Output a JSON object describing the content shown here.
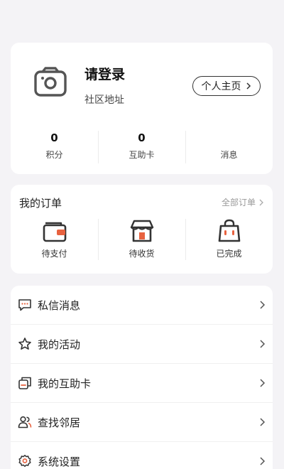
{
  "profile": {
    "login_title": "请登录",
    "community_address": "社区地址",
    "home_button_label": "个人主页",
    "stats": [
      {
        "value": "0",
        "label": "积分"
      },
      {
        "value": "0",
        "label": "互助卡"
      },
      {
        "value": "",
        "label": "消息"
      }
    ]
  },
  "orders": {
    "title": "我的订单",
    "all_label": "全部订单",
    "items": [
      {
        "label": "待支付",
        "icon": "wallet-icon"
      },
      {
        "label": "待收货",
        "icon": "shop-icon"
      },
      {
        "label": "已完成",
        "icon": "bag-icon"
      }
    ]
  },
  "menu": {
    "items": [
      {
        "label": "私信消息",
        "icon": "message-icon"
      },
      {
        "label": "我的活动",
        "icon": "star-icon"
      },
      {
        "label": "我的互助卡",
        "icon": "card-icon"
      },
      {
        "label": "查找邻居",
        "icon": "people-icon"
      },
      {
        "label": "系统设置",
        "icon": "gear-icon"
      }
    ]
  },
  "colors": {
    "background": "#f4f3f6",
    "card": "#ffffff",
    "accent": "#e8623f",
    "icon_stroke": "#333333"
  }
}
